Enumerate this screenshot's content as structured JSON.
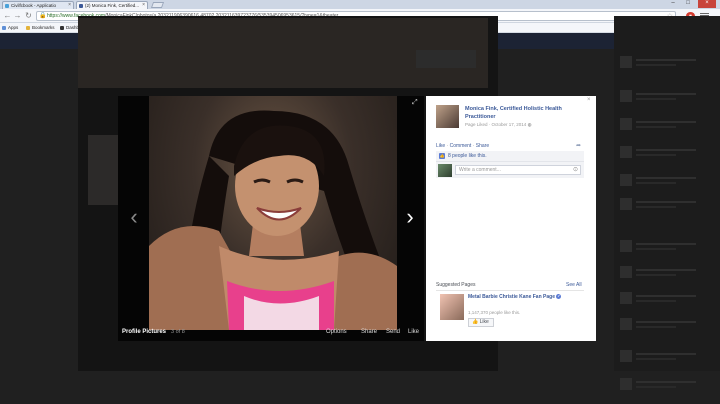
{
  "browser": {
    "tabs": [
      {
        "label": "Civilfcbook - Applicatio",
        "color": "#4aa1d8",
        "active": false
      },
      {
        "label": "(2) Monica Fink, Certified...",
        "color": "#3b5998",
        "active": true
      }
    ],
    "url_host": "https://www.facebook.com",
    "url_path": "/MonicaFinkC/photos/a.203211906390616.48702.203211639723776/535394506953615/?type=1&theater",
    "bookmarks": [
      {
        "label": "Apps",
        "color": "#5f8fd6"
      },
      {
        "label": "Bookmarks",
        "color": "#e3b33b"
      },
      {
        "label": "Dashboard",
        "color": "#333333"
      },
      {
        "label": "Nitasaad2DOG - Twit...",
        "color": "#59aee6"
      },
      {
        "label": "Photo editor | PicMo...",
        "color": "#e3b33b"
      },
      {
        "label": "PETA - Project Real...",
        "color": "#e3b33b"
      },
      {
        "label": "Home - Dropbox",
        "color": "#3c84d6"
      },
      {
        "label": "YouTube",
        "color": "#d23a2e"
      },
      {
        "label": "The Edge Podcast",
        "color": "#e3b33b"
      }
    ]
  },
  "viewer": {
    "album": "Profile Pictures",
    "count": "3 of 8",
    "actions": [
      "Options",
      "Share",
      "Send",
      "Like"
    ]
  },
  "panel": {
    "owner_name": "Monica Fink, Certified Holistic Health Practitioner",
    "owner_meta": "Page Liked · October 17, 2014",
    "actions": [
      "Like",
      "Comment",
      "Share"
    ],
    "likes": "8 people like this.",
    "comment_placeholder": "Write a comment...",
    "suggested_title": "Suggested Pages",
    "see_all": "See All",
    "suggested": {
      "name": "Metal Barbie Christie Kane Fan Page",
      "likes": "1,147,370 people like this.",
      "like_button": "Like"
    }
  },
  "colors": {
    "fb_blue": "#3b5998",
    "accent_pink": "#e8408c"
  }
}
